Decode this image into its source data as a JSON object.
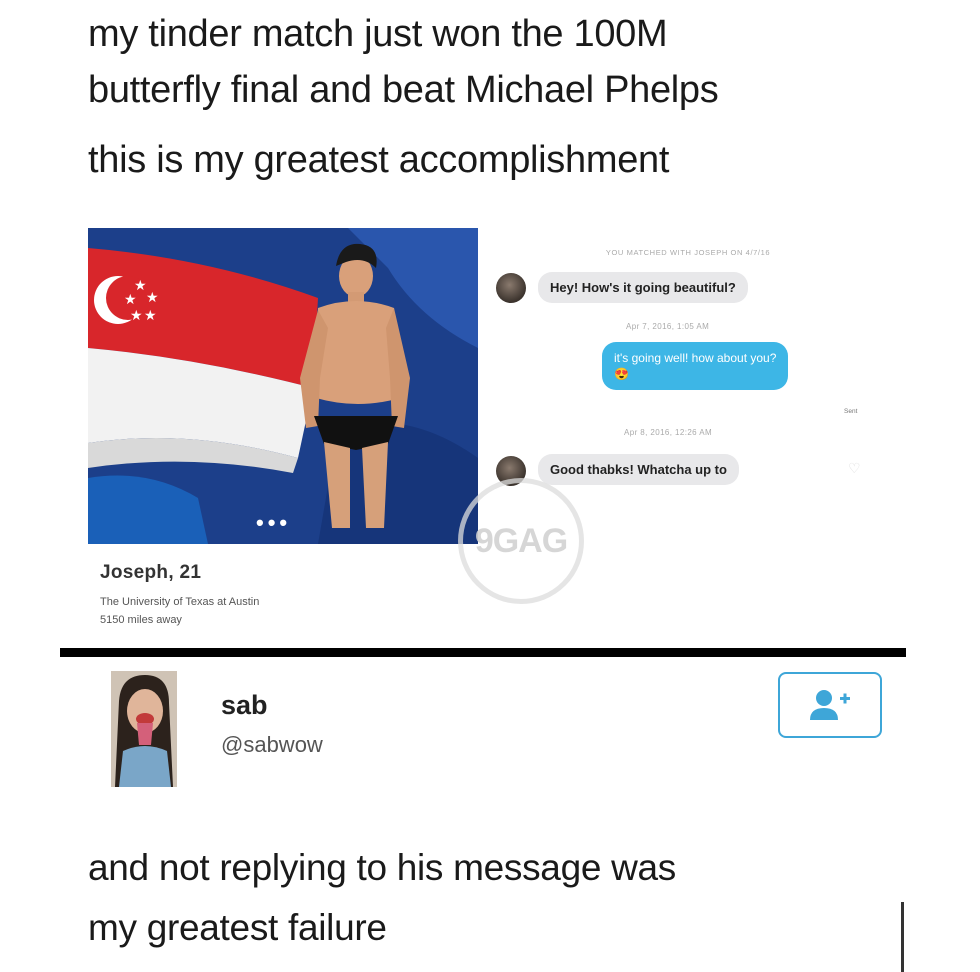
{
  "caption": {
    "line1": "my tinder match just won the 100M",
    "line2": "butterfly final and beat Michael Phelps",
    "line3": "this is my greatest accomplishment"
  },
  "profile": {
    "name": "Joseph, 21",
    "school": "The University of Texas at Austin",
    "distance": "5150 miles away",
    "more_dots": "•••"
  },
  "chat": {
    "header": "YOU MATCHED WITH JOSEPH ON 4/7/16",
    "messages": [
      {
        "from": "them",
        "text": "Hey! How's it going beautiful?"
      },
      {
        "timestamp": "Apr 7, 2016, 1:05 AM"
      },
      {
        "from": "me",
        "text": "it's going well! how about you?",
        "emoji": "😍"
      },
      {
        "status": "Sent"
      },
      {
        "timestamp": "Apr 8, 2016, 12:26 AM"
      },
      {
        "from": "them",
        "text": "Good thabks! Whatcha up to"
      }
    ]
  },
  "watermark": "9GAG",
  "tweet": {
    "name": "sab",
    "handle": "@sabwow",
    "line1": "and not replying to his message was",
    "line2": "my greatest failure"
  },
  "colors": {
    "accent": "#3db6e6",
    "follow_border": "#3ea6d8",
    "flag_red": "#d8262b",
    "background_blue": "#1c3f8a"
  },
  "icons": {
    "follow": "add-user-icon",
    "like": "heart-outline-icon"
  }
}
